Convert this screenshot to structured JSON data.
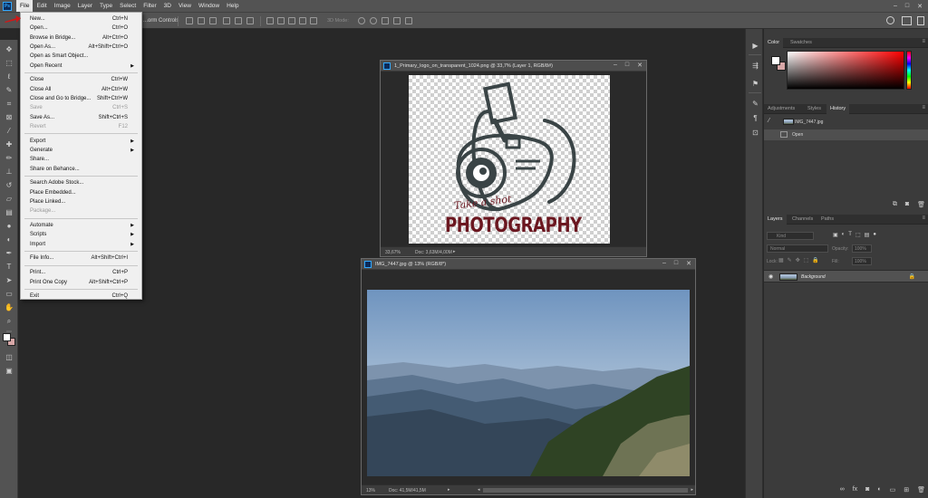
{
  "app": {
    "logo": "Ps",
    "menus": [
      "File",
      "Edit",
      "Image",
      "Layer",
      "Type",
      "Select",
      "Filter",
      "3D",
      "View",
      "Window",
      "Help"
    ],
    "window_controls": [
      "–",
      "□",
      "✕"
    ]
  },
  "options_bar": {
    "transform_label": "...orm Controls",
    "mode_3d": "3D Mode:"
  },
  "file_menu": [
    {
      "label": "New...",
      "shortcut": "Ctrl+N"
    },
    {
      "label": "Open...",
      "shortcut": "Ctrl+O"
    },
    {
      "label": "Browse in Bridge...",
      "shortcut": "Alt+Ctrl+O"
    },
    {
      "label": "Open As...",
      "shortcut": "Alt+Shift+Ctrl+O"
    },
    {
      "label": "Open as Smart Object..."
    },
    {
      "label": "Open Recent",
      "submenu": true
    },
    {
      "label": "Close",
      "shortcut": "Ctrl+W"
    },
    {
      "label": "Close All",
      "shortcut": "Alt+Ctrl+W"
    },
    {
      "label": "Close and Go to Bridge...",
      "shortcut": "Shift+Ctrl+W"
    },
    {
      "label": "Save",
      "shortcut": "Ctrl+S",
      "disabled": true
    },
    {
      "label": "Save As...",
      "shortcut": "Shift+Ctrl+S"
    },
    {
      "label": "Revert",
      "shortcut": "F12",
      "disabled": true
    },
    {
      "label": "Export",
      "submenu": true
    },
    {
      "label": "Generate",
      "submenu": true
    },
    {
      "label": "Share..."
    },
    {
      "label": "Share on Behance..."
    },
    {
      "label": "Search Adobe Stock..."
    },
    {
      "label": "Place Embedded..."
    },
    {
      "label": "Place Linked..."
    },
    {
      "label": "Package...",
      "disabled": true
    },
    {
      "label": "Automate",
      "submenu": true
    },
    {
      "label": "Scripts",
      "submenu": true
    },
    {
      "label": "Import",
      "submenu": true
    },
    {
      "label": "File Info...",
      "shortcut": "Alt+Shift+Ctrl+I"
    },
    {
      "label": "Print...",
      "shortcut": "Ctrl+P"
    },
    {
      "label": "Print One Copy",
      "shortcut": "Alt+Shift+Ctrl+P"
    },
    {
      "label": "Exit",
      "shortcut": "Ctrl+Q"
    }
  ],
  "doc1": {
    "title": "1_Primary_logo_on_transparent_1024.png @ 33,7% (Layer 1, RGB/8#)",
    "zoom": "33,67%",
    "doc_size": "Doc: 3,63M/4,00M",
    "logo_text_top": "Take a shot",
    "logo_text_main": "PHOTOGRAPHY"
  },
  "doc2": {
    "title": "IMG_7447.jpg @ 13% (RGB/8*)",
    "zoom": "13%",
    "doc_size": "Doc: 41,5M/41,5M"
  },
  "color_panel": {
    "tabs": [
      "Color",
      "Swatches"
    ],
    "foreground": "#ffffff",
    "background": "#d7a7a7"
  },
  "history_panel": {
    "tabs": [
      "Adjustments",
      "Styles",
      "History"
    ],
    "snapshot": "IMG_7447.jpg",
    "steps": [
      "Open"
    ]
  },
  "layers_panel": {
    "tabs": [
      "Layers",
      "Channels",
      "Paths"
    ],
    "filter_placeholder": "Kind",
    "blend_mode": "Normal",
    "opacity_label": "Opacity:",
    "opacity": "100%",
    "lock_label": "Lock:",
    "fill_label": "Fill:",
    "fill": "100%",
    "layers": [
      {
        "name": "Background",
        "locked": true,
        "visible": true
      }
    ]
  }
}
